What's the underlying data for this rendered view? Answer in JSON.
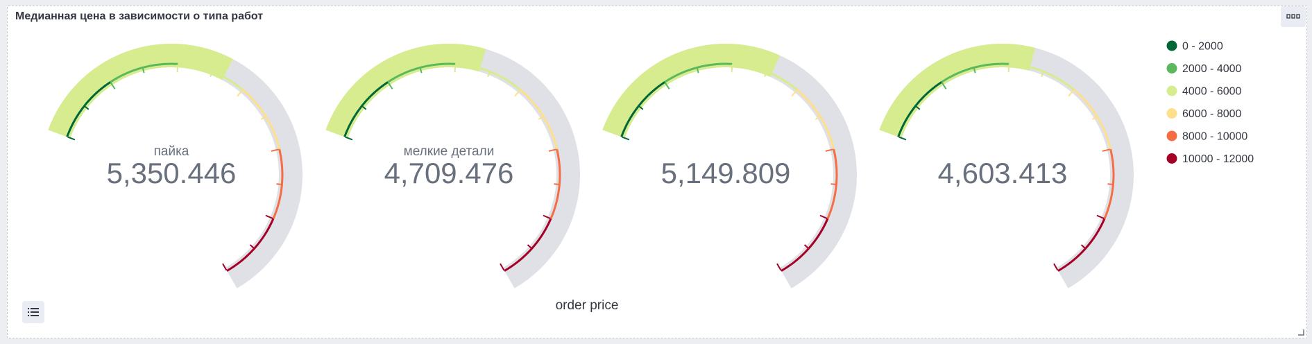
{
  "panel": {
    "title": "Медианная цена в зависимости о типа работ",
    "options_icon": "ellipsis-icon",
    "legend_toggle_icon": "list-icon",
    "resize_icon": "resize-corner-icon"
  },
  "colors": {
    "track": "#e0e1e6",
    "fill": "#d6ec8e",
    "panel_border": "#c3c8d1"
  },
  "chart_data": {
    "type": "gauge",
    "range": [
      0,
      12000
    ],
    "xlabel": "order price",
    "legend_position": "right",
    "bands": [
      {
        "label": "0 - 2000",
        "from": 0,
        "to": 2000,
        "color": "#006837"
      },
      {
        "label": "2000 - 4000",
        "from": 2000,
        "to": 4000,
        "color": "#5cb85c"
      },
      {
        "label": "4000 - 6000",
        "from": 4000,
        "to": 6000,
        "color": "#d6ec8e"
      },
      {
        "label": "6000 - 8000",
        "from": 6000,
        "to": 8000,
        "color": "#fedf8b"
      },
      {
        "label": "8000 - 10000",
        "from": 8000,
        "to": 10000,
        "color": "#f46d43"
      },
      {
        "label": "10000 - 12000",
        "from": 10000,
        "to": 12000,
        "color": "#a50026"
      }
    ],
    "gauges": [
      {
        "label": "пайка",
        "value": 5350.446,
        "value_text": "5,350.446"
      },
      {
        "label": "мелкие детали",
        "value": 4709.476,
        "value_text": "4,709.476"
      },
      {
        "label": "",
        "value": 5149.809,
        "value_text": "5,149.809"
      },
      {
        "label": "",
        "value": 4603.413,
        "value_text": "4,603.413"
      }
    ]
  }
}
